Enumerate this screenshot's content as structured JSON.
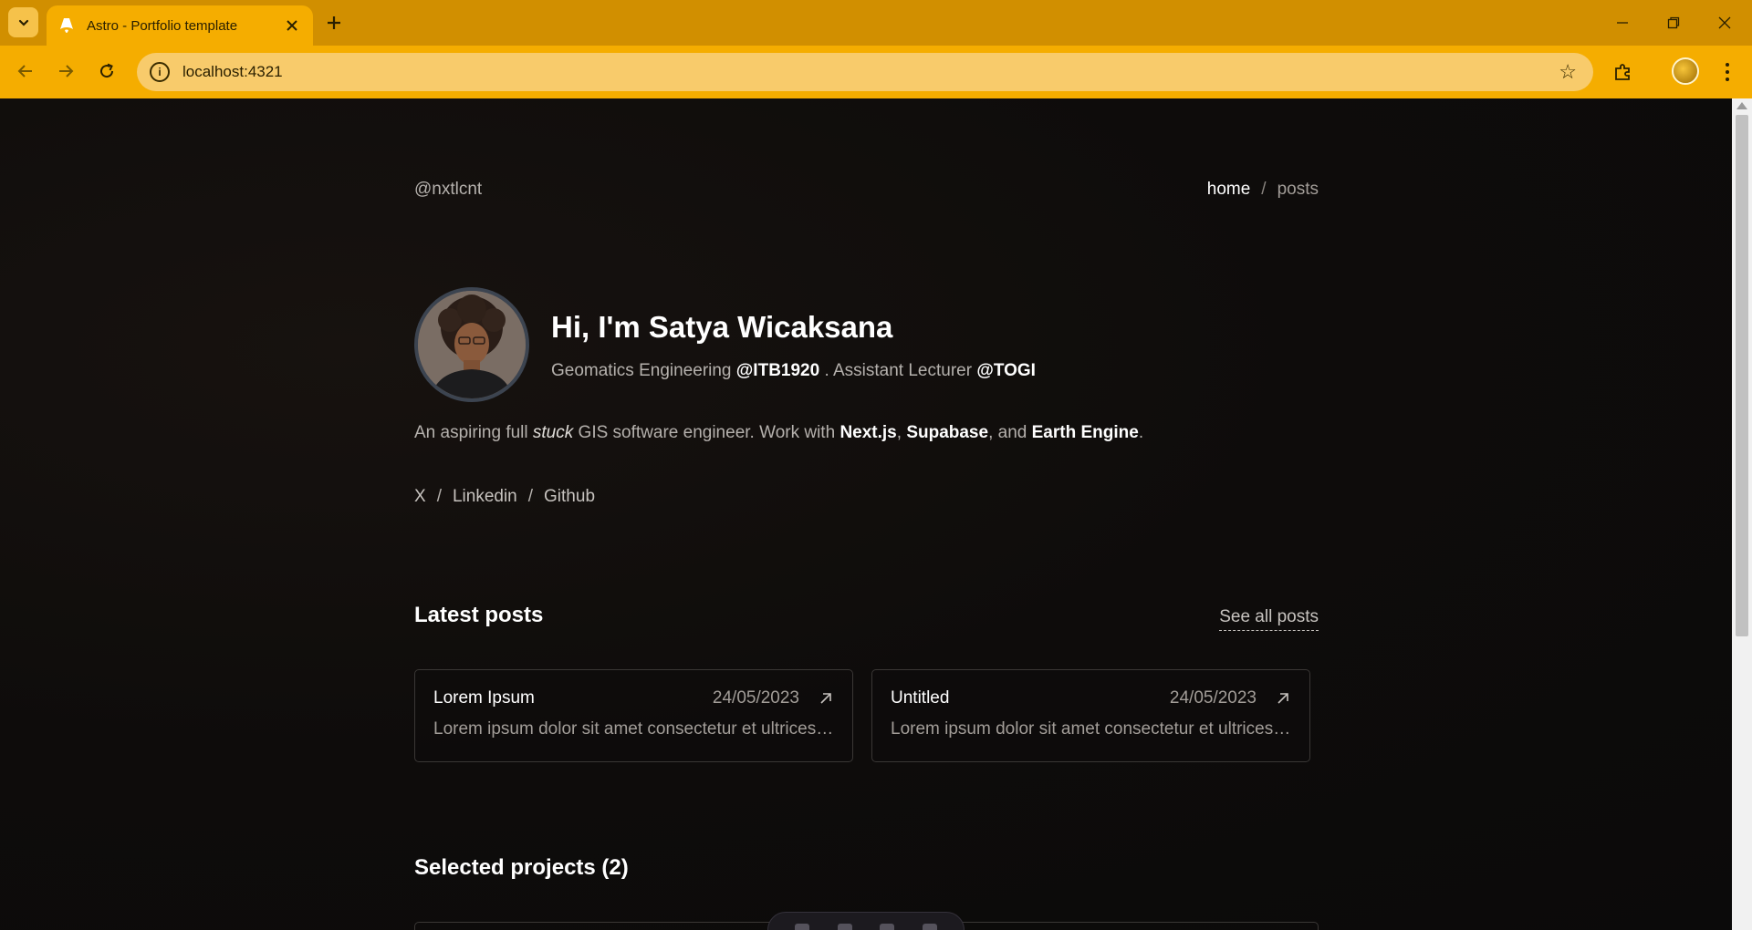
{
  "browser": {
    "tab_title": "Astro - Portfolio template",
    "url": "localhost:4321",
    "tab_close_glyph": "✕",
    "new_tab_glyph": "+"
  },
  "header": {
    "handle": "@nxtlcnt",
    "nav": [
      {
        "label": "home",
        "active": true
      },
      {
        "label": "posts",
        "active": false
      }
    ],
    "separator": "/"
  },
  "hero": {
    "name": "Hi, I'm Satya Wicaksana",
    "sub_prefix": "Geomatics Engineering ",
    "sub_org1": "@ITB1920",
    "sub_middle": " . Assistant Lecturer ",
    "sub_org2": "@TOGI"
  },
  "bio": {
    "part1": "An aspiring full ",
    "emph": "stuck",
    "part2": " GIS software engineer. Work with ",
    "tech1": "Next.js",
    "comma1": ", ",
    "tech2": "Supabase",
    "and": ", and ",
    "tech3": "Earth Engine",
    "end": "."
  },
  "socials": {
    "items": [
      "X",
      "Linkedin",
      "Github"
    ],
    "separator": "/"
  },
  "latest_posts": {
    "title": "Latest posts",
    "see_all": "See all posts",
    "posts": [
      {
        "title": "Lorem Ipsum",
        "date": "24/05/2023",
        "excerpt": "Lorem ipsum dolor sit amet consectetur et ultrices ..."
      },
      {
        "title": "Untitled",
        "date": "24/05/2023",
        "excerpt": "Lorem ipsum dolor sit amet consectetur et ultrices ..."
      }
    ]
  },
  "projects": {
    "title": "Selected projects (2)"
  },
  "colors": {
    "chrome_dark": "#d18f00",
    "chrome_light": "#f5ad00",
    "omnibox": "#f8cb6b",
    "page_bg": "#0d0b0a",
    "text_primary": "#ffffff",
    "text_muted": "#a29d98"
  },
  "icons": {
    "tab_search": "chevron-down-icon",
    "favicon": "astro-icon",
    "back": "arrow-left-icon",
    "forward": "arrow-right-icon",
    "reload": "reload-icon",
    "site_info": "info-icon",
    "bookmark": "star-icon",
    "extensions": "puzzle-icon",
    "menu": "kebab-menu-icon",
    "post_link": "arrow-up-right-icon"
  }
}
